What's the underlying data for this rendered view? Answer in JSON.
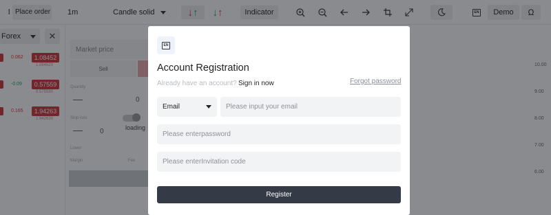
{
  "toolbar": {
    "stub_label": "l",
    "place_order": "Place order",
    "interval": "1m",
    "chart_style": "Candle solid",
    "indicator": "Indicator",
    "language_badge": "EN",
    "account_mode": "Demo",
    "icons": [
      "arrow-down-red",
      "arrow-up-green",
      "arrow-down-green",
      "arrow-up-red",
      "zoom-in",
      "zoom-out",
      "arrow-left",
      "arrow-right",
      "crop",
      "fullscreen",
      "moon",
      "language",
      "omega"
    ],
    "colors": {
      "up": "#1fa35b",
      "down": "#e0303a"
    }
  },
  "left_panel": {
    "market_select": "Forex",
    "quotes": [
      {
        "change": "0.062",
        "price": "1.08452",
        "sub": "1.084520"
      },
      {
        "change": "-0.09",
        "price": "0.57559",
        "sub": "0.575590"
      },
      {
        "change": "0.165",
        "price": "1.94263",
        "sub": "1.942630"
      }
    ]
  },
  "order_panel": {
    "order_type": "Market price",
    "sell_label": "Sell",
    "qty_label": "Quantity",
    "qty_value": "0",
    "stop_label": "Stop loss",
    "stop_value": "0",
    "loading": "loading",
    "lower_label": "Lower",
    "margin_label": "Margin",
    "fee_label": "Fee"
  },
  "chart_axis": [
    "10.00",
    "9.00",
    "8.00",
    "7.00",
    "6.00"
  ],
  "modal": {
    "title": "Account Registration",
    "have_account": "Already have an account?",
    "sign_in": "Sign in now",
    "forgot": "Forgot password",
    "email_type": "Email",
    "email_placeholder": "Please input your email",
    "password_placeholder": "Please enterpassword",
    "invite_placeholder": "Please enterInvitation code",
    "register": "Register",
    "logo_text": "EN",
    "button_color": "#343b47"
  }
}
